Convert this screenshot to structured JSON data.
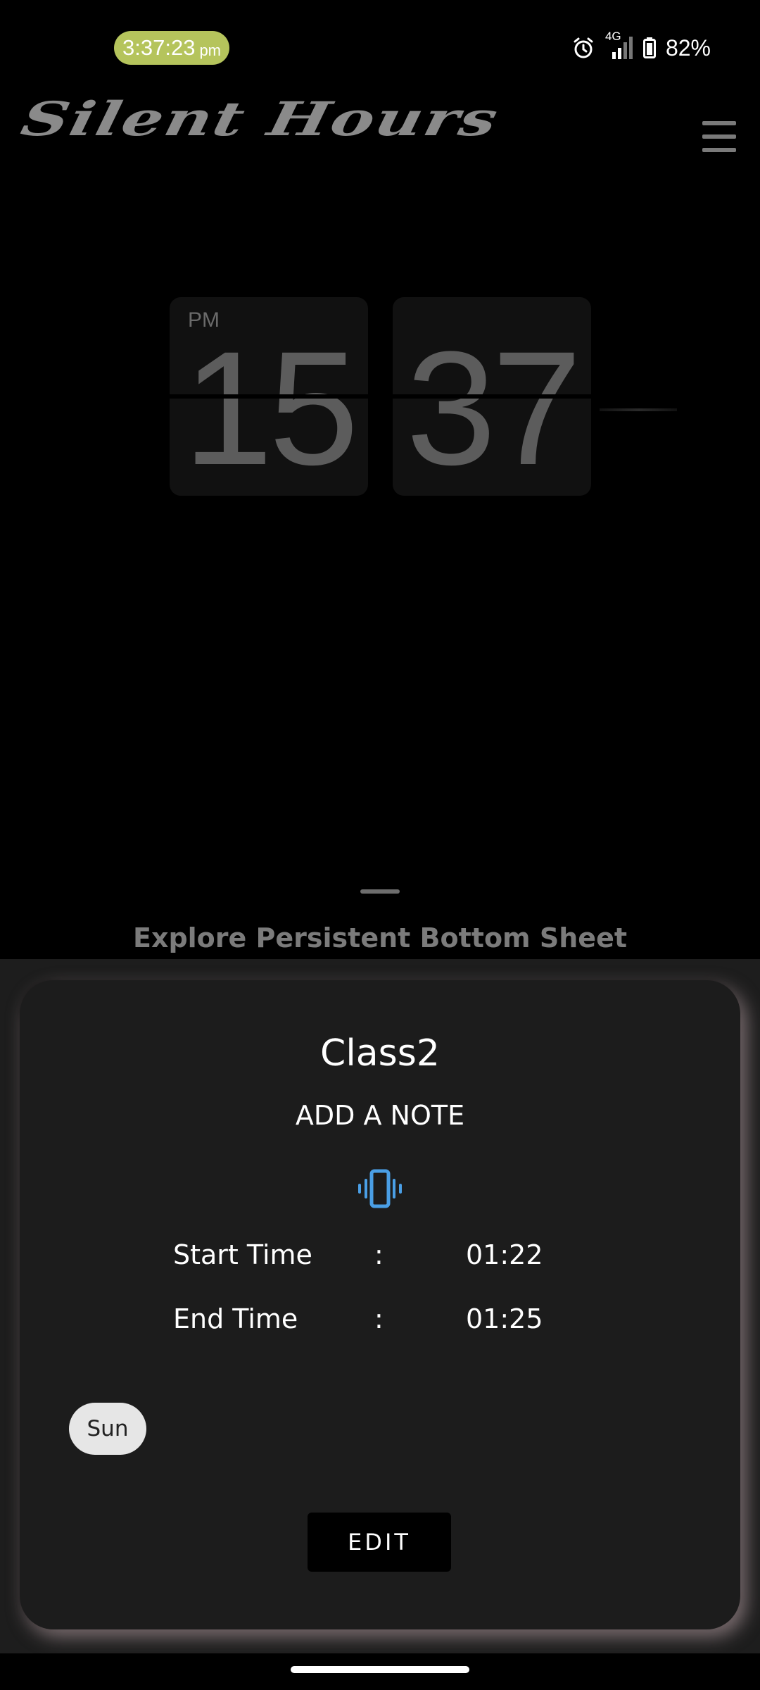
{
  "status_bar": {
    "time": "3:37:23",
    "ampm": "pm",
    "network": "4G",
    "battery": "82%",
    "pill_color": "#b5c45c"
  },
  "header": {
    "app_title": "Silent Hours",
    "menu_icon": "hamburger-menu-icon"
  },
  "clock": {
    "ampm": "PM",
    "hours": "15",
    "minutes": "37"
  },
  "bottom_sheet": {
    "title": "Explore Persistent Bottom Sheet"
  },
  "profile_card": {
    "name": "Class2",
    "note_label": "ADD A NOTE",
    "mode_icon": "vibrate-icon",
    "mode_color": "#4a9fe6",
    "start_label": "Start Time",
    "end_label": "End Time",
    "separator": ":",
    "start_time": "01:22",
    "end_time": "01:25",
    "days": [
      "Sun"
    ],
    "edit_label": "EDIT"
  }
}
